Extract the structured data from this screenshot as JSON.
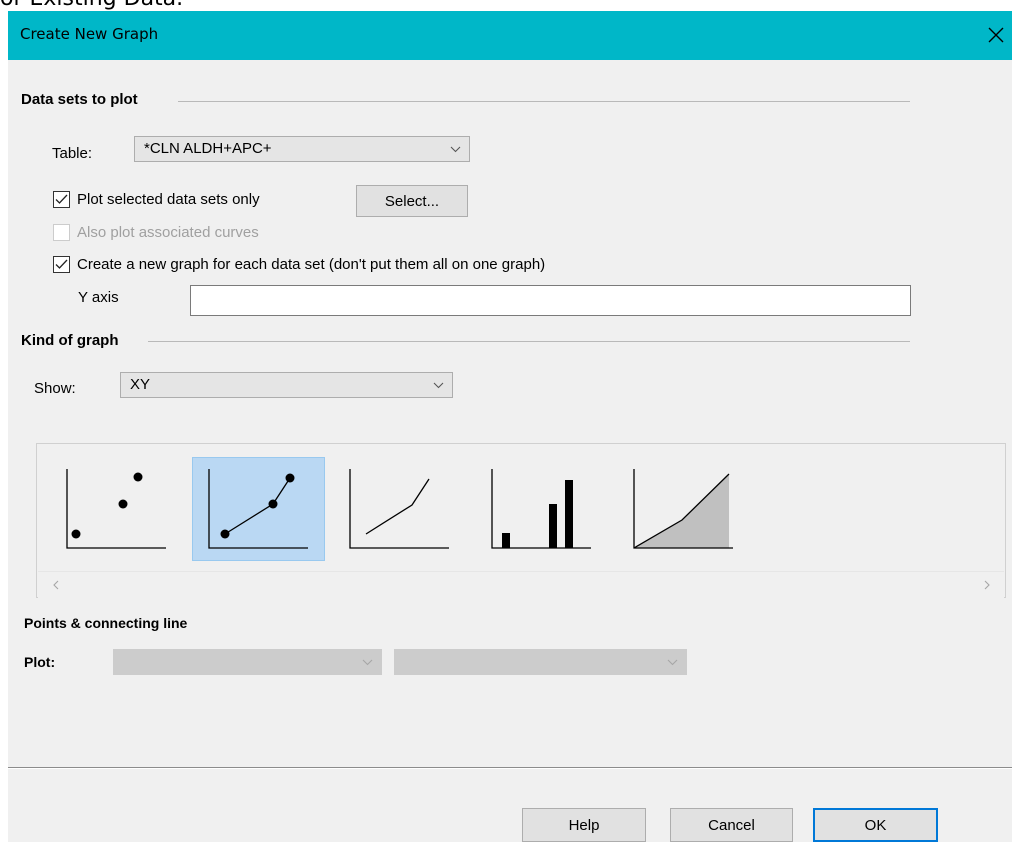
{
  "background_heading": "or Existing Data.",
  "dialog": {
    "title": "Create New Graph",
    "titlebar_color": "#00b7c8"
  },
  "data_sets": {
    "heading": "Data sets to plot",
    "table_label": "Table:",
    "table_value": "*CLN ALDH+APC+",
    "plot_selected_label": "Plot selected data sets only",
    "plot_selected_checked": true,
    "select_button": "Select...",
    "associated_curves_label": "Also plot associated curves",
    "associated_curves_checked": false,
    "new_graph_each_label": "Create a new graph for each data set (don't put them all on one graph)",
    "new_graph_each_checked": true,
    "y_axis_label": "Y axis",
    "y_axis_value": ""
  },
  "kind": {
    "heading": "Kind of graph",
    "show_label": "Show:",
    "show_value": "XY",
    "thumbnails": [
      {
        "name": "points-only",
        "selected": false
      },
      {
        "name": "points-and-connecting-line",
        "selected": true
      },
      {
        "name": "connecting-line-only",
        "selected": false
      },
      {
        "name": "spikes",
        "selected": false
      },
      {
        "name": "area-fill",
        "selected": false
      }
    ],
    "selection_name": "Points & connecting line",
    "plot_label": "Plot:",
    "plot_value_1": "",
    "plot_value_2": ""
  },
  "buttons": {
    "help": "Help",
    "cancel": "Cancel",
    "ok": "OK"
  }
}
